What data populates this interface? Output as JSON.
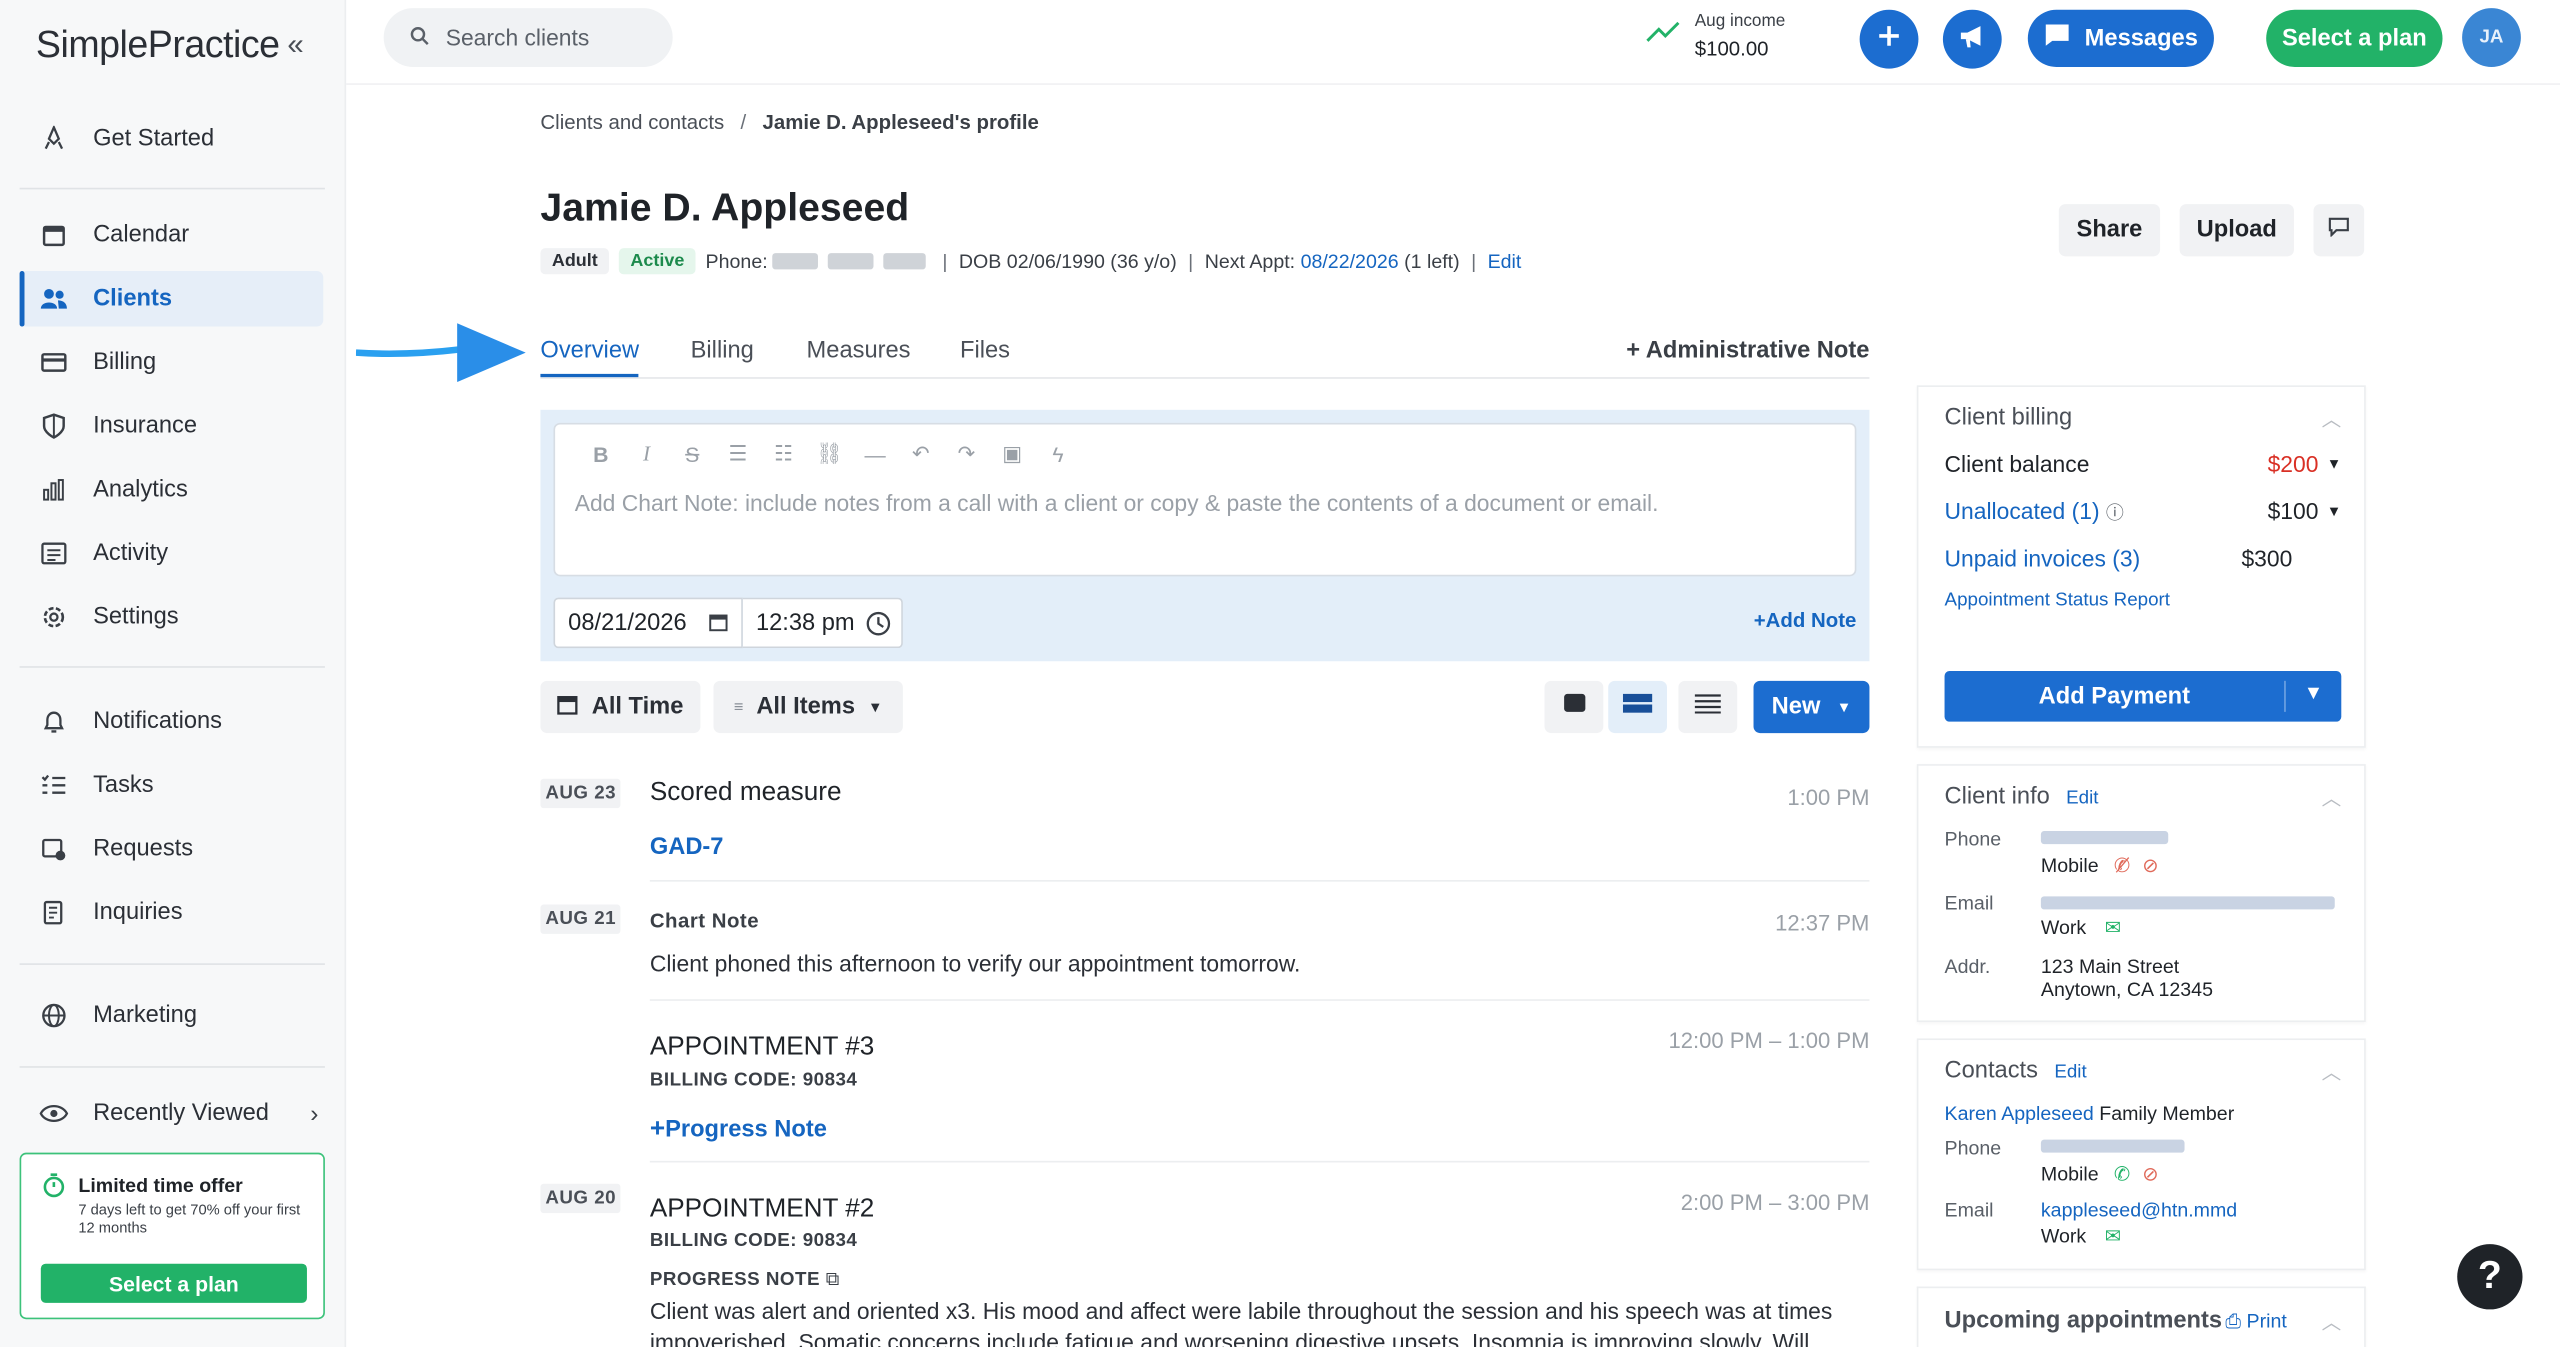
{
  "app": {
    "logo": "SimplePractice"
  },
  "sidebar": {
    "items": [
      {
        "label": "Get Started"
      },
      {
        "label": "Calendar"
      },
      {
        "label": "Clients"
      },
      {
        "label": "Billing"
      },
      {
        "label": "Insurance"
      },
      {
        "label": "Analytics"
      },
      {
        "label": "Activity"
      },
      {
        "label": "Settings"
      },
      {
        "label": "Notifications"
      },
      {
        "label": "Tasks"
      },
      {
        "label": "Requests"
      },
      {
        "label": "Inquiries"
      },
      {
        "label": "Marketing"
      },
      {
        "label": "Recently Viewed"
      }
    ],
    "active": "Clients",
    "offer": {
      "title": "Limited time offer",
      "desc": "7 days left to get 70% off your first 12 months",
      "button": "Select a plan"
    }
  },
  "topbar": {
    "search_placeholder": "Search clients",
    "income_label": "Aug income",
    "income_value": "$100.00",
    "messages": "Messages",
    "select_plan": "Select a plan",
    "avatar_initials": "JA"
  },
  "breadcrumb": {
    "parent": "Clients and contacts",
    "current": "Jamie D. Appleseed's profile"
  },
  "client": {
    "name": "Jamie D. Appleseed",
    "type_badge": "Adult",
    "status_badge": "Active",
    "phone_label": "Phone:",
    "dob": "DOB 02/06/1990 (36 y/o)",
    "next_appt_label": "Next Appt:",
    "next_appt_date": "08/22/2026",
    "next_appt_left": "(1 left)",
    "edit": "Edit"
  },
  "header_buttons": {
    "share": "Share",
    "upload": "Upload"
  },
  "tabs": [
    {
      "label": "Overview"
    },
    {
      "label": "Billing"
    },
    {
      "label": "Measures"
    },
    {
      "label": "Files"
    }
  ],
  "admin_note": "Administrative Note",
  "editor": {
    "placeholder": "Add Chart Note: include notes from a call with a client or copy & paste the contents of a document or email.",
    "date": "08/21/2026",
    "time": "12:38 pm",
    "add_note": "Add Note"
  },
  "filters": {
    "time": "All Time",
    "items": "All Items",
    "new": "New"
  },
  "timeline": [
    {
      "day": "AUG 23",
      "title": "Scored measure",
      "time": "1:00 PM",
      "link": "GAD-7"
    },
    {
      "day": "AUG 21",
      "title": "Chart Note",
      "time": "12:37 PM",
      "text": "Client phoned this afternoon to verify our appointment tomorrow."
    },
    {
      "title": "APPOINTMENT #3",
      "code": "BILLING CODE: 90834",
      "time": "12:00 PM – 1:00 PM",
      "link": "Progress Note"
    },
    {
      "day": "AUG 20",
      "title": "APPOINTMENT #2",
      "code": "BILLING CODE: 90834",
      "time": "2:00 PM – 3:00 PM",
      "note_label": "PROGRESS NOTE",
      "text": "Client was alert and oriented x3. His mood and affect were labile throughout the session and his speech was at times",
      "text2": "impoverished. Somatic concerns include fatigue and worsening digestive upsets. Insomnia is improving slowly. Will"
    }
  ],
  "billing_card": {
    "title": "Client billing",
    "balance_label": "Client balance",
    "balance_value": "$200",
    "unallocated_label": "Unallocated (1)",
    "unallocated_value": "$100",
    "unpaid_label": "Unpaid invoices (3)",
    "unpaid_value": "$300",
    "report": "Appointment Status Report",
    "add_payment": "Add Payment",
    "balance_color": "#d93025"
  },
  "info_card": {
    "title": "Client info",
    "edit": "Edit",
    "phone_label": "Phone",
    "phone_type": "Mobile",
    "email_label": "Email",
    "email_type": "Work",
    "addr_label": "Addr.",
    "addr1": "123 Main Street",
    "addr2": "Anytown, CA 12345"
  },
  "contacts_card": {
    "title": "Contacts",
    "edit": "Edit",
    "contact_name": "Karen Appleseed",
    "contact_rel": "Family Member",
    "phone_label": "Phone",
    "phone_type": "Mobile",
    "email_label": "Email",
    "email_value": "kappleseed@htn.mmd",
    "email_type": "Work"
  },
  "appointments_card": {
    "title": "Upcoming appointments",
    "print": "Print"
  },
  "help": "?"
}
